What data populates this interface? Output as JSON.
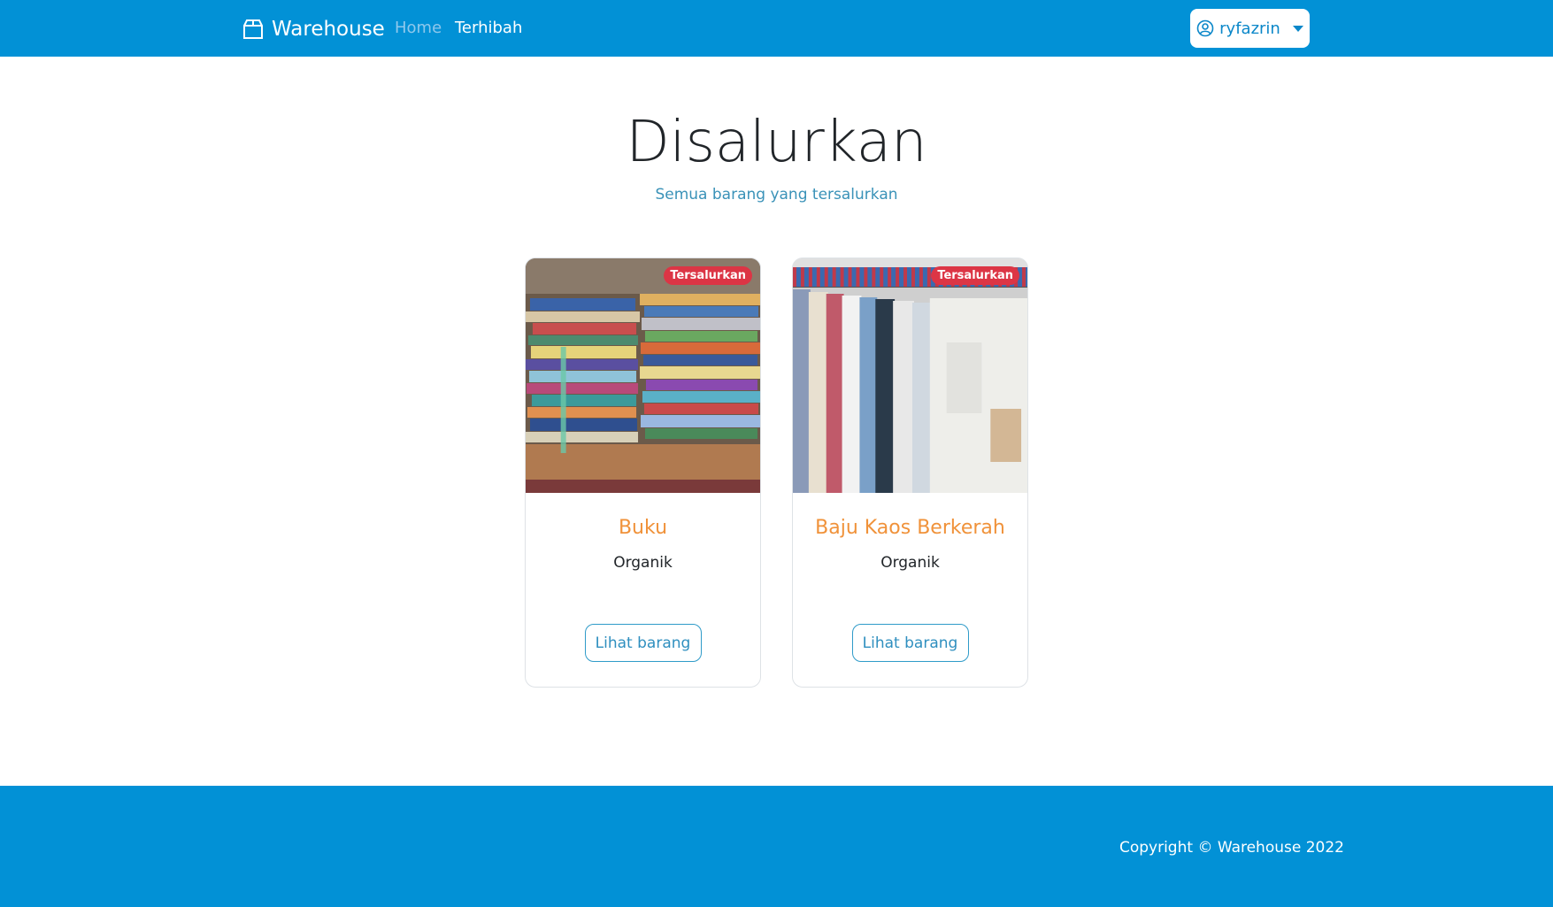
{
  "navbar": {
    "brand": "Warehouse",
    "brand_icon": "box-icon",
    "links": [
      {
        "label": "Home",
        "active": false
      },
      {
        "label": "Terhibah",
        "active": true
      }
    ],
    "user": {
      "name": "ryfazrin",
      "icon": "user-circle-icon"
    }
  },
  "header": {
    "title": "Disalurkan",
    "subtitle": "Semua barang yang tersalurkan"
  },
  "cards": [
    {
      "title": "Buku",
      "category": "Organik",
      "badge": "Tersalurkan",
      "button": "Lihat barang",
      "image": "books-photo"
    },
    {
      "title": "Baju Kaos Berkerah",
      "category": "Organik",
      "badge": "Tersalurkan",
      "button": "Lihat barang",
      "image": "clothes-rack-photo"
    }
  ],
  "footer": {
    "copyright": "Copyright © Warehouse 2022"
  },
  "colors": {
    "primary": "#0291d6",
    "card_title": "#f0923a",
    "badge": "#dc3545",
    "outline_button": "#2f9bc9"
  }
}
